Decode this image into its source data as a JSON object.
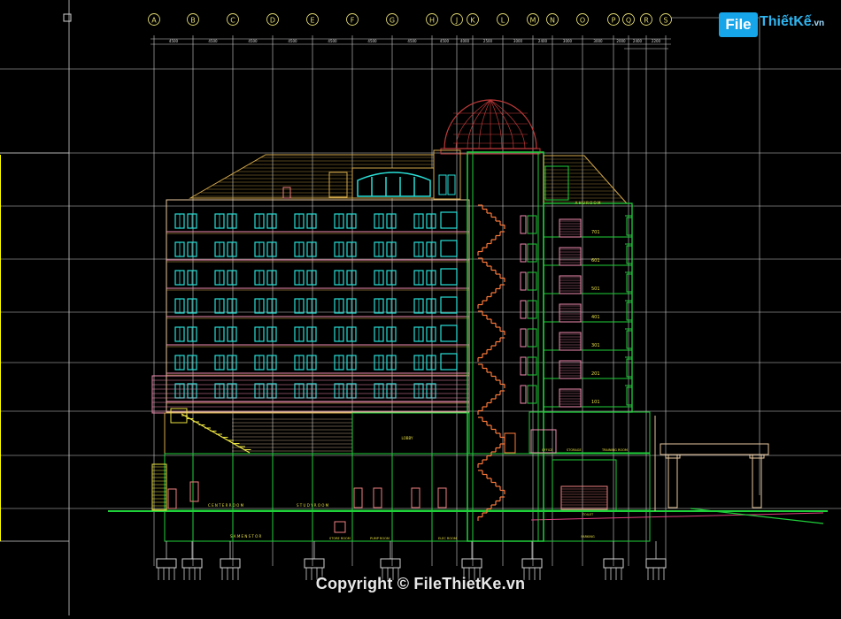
{
  "watermark": {
    "logo_box": "File",
    "logo_name": "ThiếtKế",
    "logo_suffix": ".vn",
    "copyright": "Copyright © FileThietKe.vn"
  },
  "grid_axes": [
    "A",
    "B",
    "C",
    "D",
    "E",
    "F",
    "G",
    "H",
    "J",
    "K",
    "L",
    "M",
    "N",
    "O",
    "P",
    "Q",
    "R",
    "S"
  ],
  "dimension_texts": [
    "4500",
    "4500",
    "4500",
    "4500",
    "4500",
    "4500",
    "4500",
    "4500",
    "4000",
    "2500",
    "3000",
    "2400",
    "3000",
    "3000",
    "2000",
    "2400",
    "2200",
    "2600"
  ],
  "room_labels": {
    "level7": "701",
    "level6": "601",
    "level5": "501",
    "level4": "401",
    "level3": "301",
    "level2": "201",
    "level1": "101",
    "top_room": "A H U   R O O M",
    "training_room": "TRAINING ROOM",
    "office_left": "OFFICE",
    "office_right": "STORAGE",
    "ground_left": "C E N T E R   R O O M",
    "ground_mid": "S T U D Y   R O O M",
    "lobby": "LOBBY",
    "basement_left": "S A M E N  S T O R",
    "basement_a": "STORE ROOM",
    "basement_b": "PUMP ROOM",
    "basement_c": "ELEC ROOM",
    "basement_d": "TOILET",
    "basement_e": "PARKING"
  },
  "colors": {
    "background": "#000000",
    "grid": "#cfcfcf",
    "facade": "#d4a84a",
    "windows": "#29e0d8",
    "frame": "#1fcf3a",
    "stair": "#ff7a3a",
    "pink": "#f08cb0",
    "beige": "#e8c9a0",
    "yellow": "#e8e040",
    "dome": "#c03a3a",
    "axis_bubble": "#e0d870"
  }
}
